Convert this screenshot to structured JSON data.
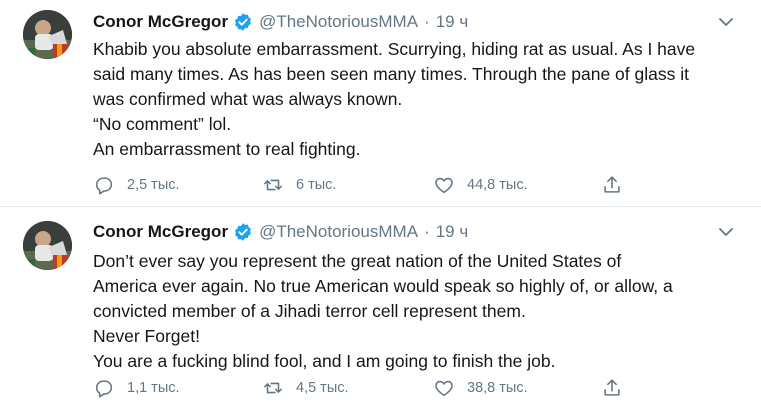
{
  "tweets": [
    {
      "author": "Conor McGregor",
      "handle": "@TheNotoriousMMA",
      "separator": "·",
      "time": "19 ч",
      "lines": [
        "Khabib you absolute embarrassment. Scurrying, hiding rat as usual. As I have",
        "said many times. As has been seen many times. Through the pane of glass it",
        "was confirmed what was always known.",
        "“No comment” lol.",
        "An embarrassment to real fighting."
      ],
      "replies": "2,5 тыс.",
      "retweets": "6 тыс.",
      "likes": "44,8 тыс."
    },
    {
      "author": "Conor McGregor",
      "handle": "@TheNotoriousMMA",
      "separator": "·",
      "time": "19 ч",
      "lines": [
        "Don’t ever say you represent the great nation of the United States of",
        "America ever again. No true American would speak so highly of, or allow, a",
        "convicted member of a Jihadi terror cell represent them.",
        "Never Forget!",
        "You are a fucking blind fool, and I am going to finish the job."
      ],
      "replies": "1,1 тыс.",
      "retweets": "4,5 тыс.",
      "likes": "38,8 тыс."
    }
  ],
  "icons": {
    "verified": "verified-badge-icon",
    "caret": "chevron-down-icon",
    "reply": "reply-bubble-icon",
    "retweet": "retweet-icon",
    "like": "heart-icon",
    "share": "share-icon"
  },
  "colors": {
    "accent": "#1da1f2",
    "text": "#14171a",
    "muted": "#657786",
    "divider": "#e6ecf0"
  }
}
